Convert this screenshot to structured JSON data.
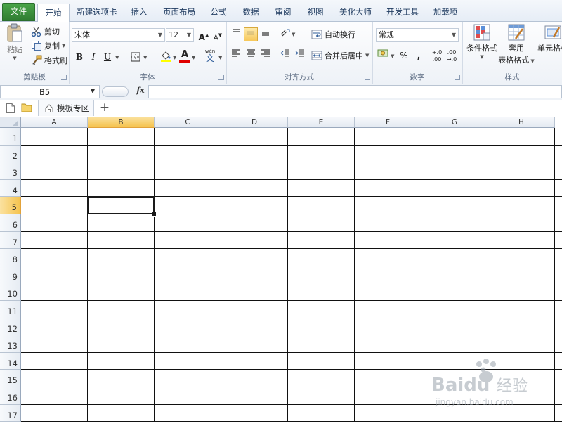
{
  "tabs": [
    {
      "label": "文件"
    },
    {
      "label": "开始"
    },
    {
      "label": "新建选项卡"
    },
    {
      "label": "插入"
    },
    {
      "label": "页面布局"
    },
    {
      "label": "公式"
    },
    {
      "label": "数据"
    },
    {
      "label": "审阅"
    },
    {
      "label": "视图"
    },
    {
      "label": "美化大师"
    },
    {
      "label": "开发工具"
    },
    {
      "label": "加载项"
    }
  ],
  "clipboard": {
    "paste": "粘贴",
    "cut": "剪切",
    "copy": "复制",
    "format_painter": "格式刷",
    "group": "剪贴板"
  },
  "font": {
    "name": "宋体",
    "size": "12",
    "group": "字体",
    "bold": "B",
    "italic": "I",
    "underline": "U",
    "grow": "A",
    "shrink": "A",
    "color_a": "A",
    "wen": "wén"
  },
  "alignment": {
    "wrap": "自动换行",
    "merge": "合并后居中",
    "group": "对齐方式"
  },
  "number": {
    "format": "常规",
    "percent": "%",
    "comma": ",",
    "group": "数字"
  },
  "styles": {
    "conditional": "条件格式",
    "table_line1": "套用",
    "table_line2": "表格格式",
    "cell_styles": "单元格样",
    "group": "样式"
  },
  "formula_bar": {
    "name_box": "B5",
    "fx": "fx",
    "content": ""
  },
  "sheetbar": {
    "template_tab": "模板专区",
    "add": "+"
  },
  "columns": [
    "A",
    "B",
    "C",
    "D",
    "E",
    "F",
    "G",
    "H"
  ],
  "rows": [
    "1",
    "2",
    "3",
    "4",
    "5",
    "6",
    "7",
    "8",
    "9",
    "10",
    "11",
    "12",
    "13",
    "14",
    "15",
    "16",
    "17"
  ],
  "selected": {
    "cell": "B5",
    "column": "B",
    "row": "5"
  },
  "watermark": {
    "brand": "Baidu",
    "cn": "经验",
    "url": "jingyan.baidu.com"
  },
  "colors": {
    "accent": "#f5c451",
    "file_tab": "#2f7d32",
    "grid_line": "#111111"
  }
}
